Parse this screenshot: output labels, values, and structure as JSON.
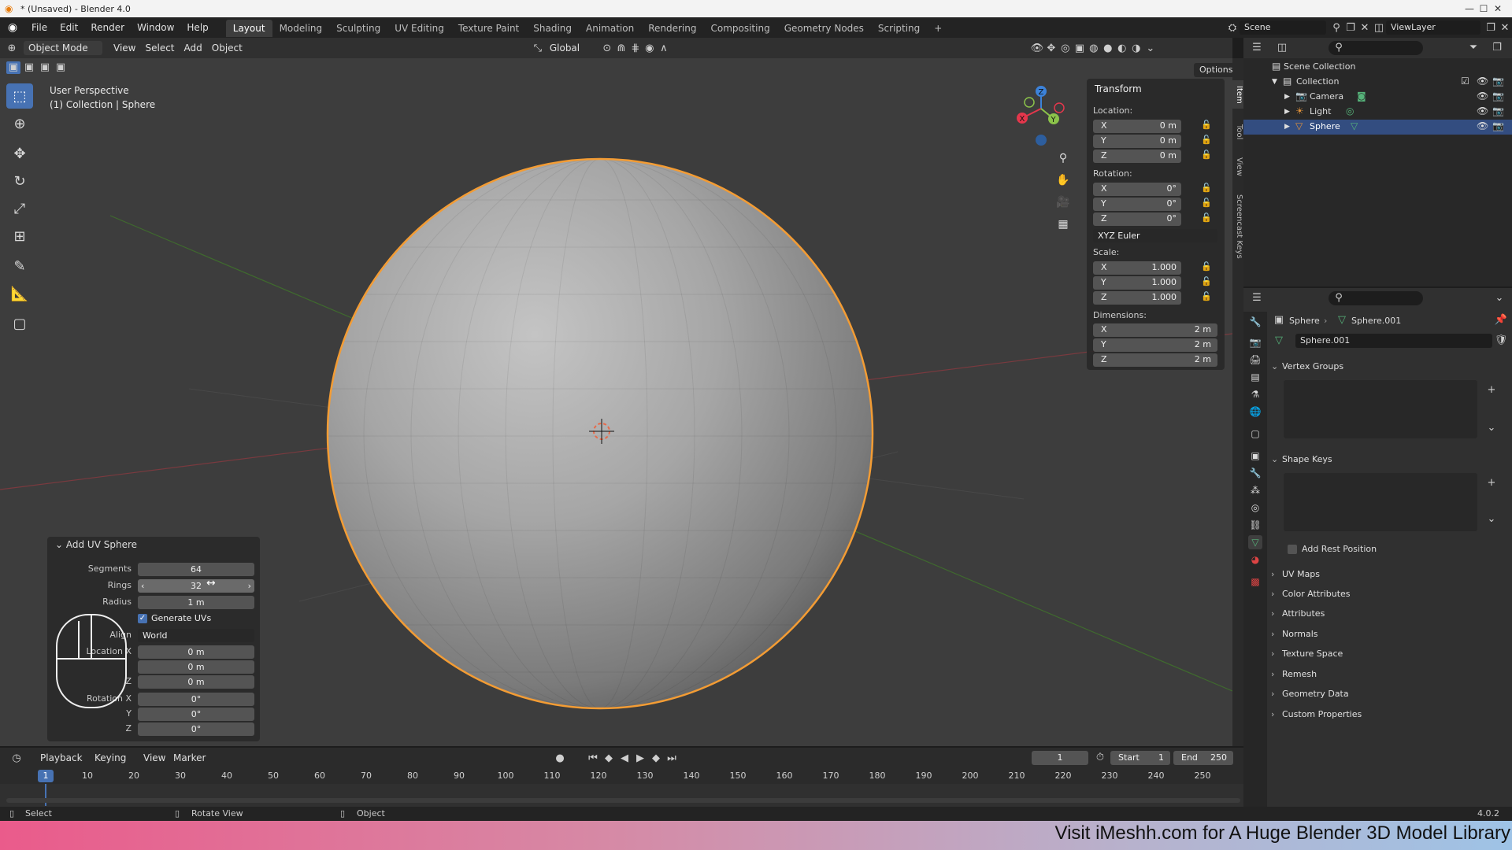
{
  "window": {
    "title": "* (Unsaved) - Blender 4.0"
  },
  "menubar": {
    "menus": [
      "File",
      "Edit",
      "Render",
      "Window",
      "Help"
    ],
    "workspaces": [
      "Layout",
      "Modeling",
      "Sculpting",
      "UV Editing",
      "Texture Paint",
      "Shading",
      "Animation",
      "Rendering",
      "Compositing",
      "Geometry Nodes",
      "Scripting"
    ],
    "active_workspace": "Layout",
    "add_workspace": "+",
    "scene": "Scene",
    "view_layer": "ViewLayer"
  },
  "viewport_header": {
    "mode": "Object Mode",
    "menus": [
      "View",
      "Select",
      "Add",
      "Object"
    ],
    "transform_orientation": "Global",
    "options": "Options"
  },
  "viewport": {
    "perspective": "User Perspective",
    "collection_info": "(1) Collection | Sphere",
    "gizmo_axes": [
      "X",
      "Y",
      "Z"
    ]
  },
  "transform_panel": {
    "title": "Transform",
    "location_label": "Location:",
    "location": [
      {
        "axis": "X",
        "value": "0 m"
      },
      {
        "axis": "Y",
        "value": "0 m"
      },
      {
        "axis": "Z",
        "value": "0 m"
      }
    ],
    "rotation_label": "Rotation:",
    "rotation": [
      {
        "axis": "X",
        "value": "0°"
      },
      {
        "axis": "Y",
        "value": "0°"
      },
      {
        "axis": "Z",
        "value": "0°"
      }
    ],
    "rotation_mode": "XYZ Euler",
    "scale_label": "Scale:",
    "scale": [
      {
        "axis": "X",
        "value": "1.000"
      },
      {
        "axis": "Y",
        "value": "1.000"
      },
      {
        "axis": "Z",
        "value": "1.000"
      }
    ],
    "dimensions_label": "Dimensions:",
    "dimensions": [
      {
        "axis": "X",
        "value": "2 m"
      },
      {
        "axis": "Y",
        "value": "2 m"
      },
      {
        "axis": "Z",
        "value": "2 m"
      }
    ]
  },
  "sidebar_tabs": [
    "Item",
    "Tool",
    "View",
    "Screencast Keys"
  ],
  "redo_panel": {
    "title": "Add UV Sphere",
    "segments_label": "Segments",
    "segments": "64",
    "rings_label": "Rings",
    "rings": "32",
    "radius_label": "Radius",
    "radius": "1 m",
    "generate_uvs": "Generate UVs",
    "align_label": "Align",
    "align": "World",
    "location_label": "Location X",
    "location": [
      "0 m",
      "0 m",
      "0 m"
    ],
    "location_z_label": "Z",
    "rotation_label": "Rotation X",
    "rotation_y_label": "Y",
    "rotation_z_label": "Z",
    "rotation": [
      "0°",
      "0°",
      "0°"
    ]
  },
  "outliner": {
    "scene_collection": "Scene Collection",
    "collection": "Collection",
    "items": [
      "Camera",
      "Light",
      "Sphere"
    ]
  },
  "properties": {
    "object": "Sphere",
    "data": "Sphere.001",
    "mesh_name": "Sphere.001",
    "vertex_groups": "Vertex Groups",
    "shape_keys": "Shape Keys",
    "add_rest_position": "Add Rest Position",
    "sections": [
      "UV Maps",
      "Color Attributes",
      "Attributes",
      "Normals",
      "Texture Space",
      "Remesh",
      "Geometry Data",
      "Custom Properties"
    ]
  },
  "timeline": {
    "menus": [
      "Playback",
      "Keying",
      "View",
      "Marker"
    ],
    "current_frame": "1",
    "start_label": "Start",
    "start": "1",
    "end_label": "End",
    "end": "250",
    "ticks": [
      "10",
      "20",
      "30",
      "40",
      "50",
      "60",
      "70",
      "80",
      "90",
      "100",
      "110",
      "120",
      "130",
      "140",
      "150",
      "160",
      "170",
      "180",
      "190",
      "200",
      "210",
      "220",
      "230",
      "240",
      "250"
    ],
    "cursor": "1"
  },
  "statusbar": {
    "select": "Select",
    "rotate": "Rotate View",
    "object": "Object",
    "version": "4.0.2"
  },
  "promo": {
    "text": "Visit iMeshh.com for A Huge Blender 3D Model Library"
  },
  "colors": {
    "accent": "#4772b3",
    "selection_outline": "#f39c34",
    "x_axis": "#e4374c",
    "y_axis": "#8bc34a",
    "z_axis": "#3c82d9"
  }
}
